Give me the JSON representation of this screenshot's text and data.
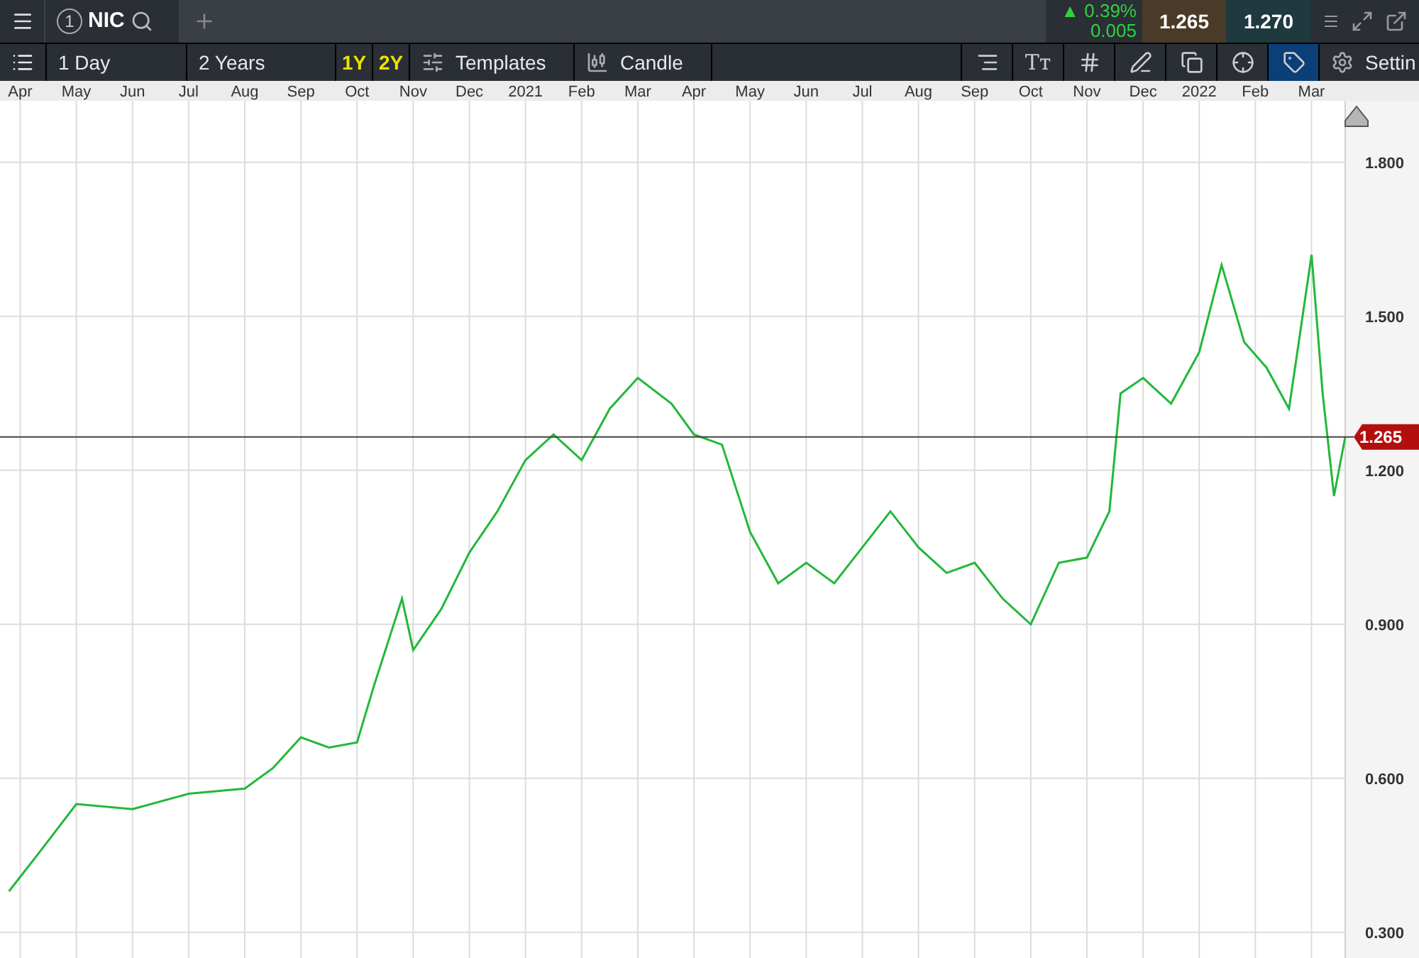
{
  "top_bar": {
    "tab": {
      "number": "1",
      "symbol": "NIC",
      "selected": true
    },
    "change": {
      "arrow": "▲",
      "percent": "0.39%",
      "absolute": "0.005"
    },
    "bid": "1.265",
    "ask": "1.270"
  },
  "toolbar": {
    "interval": "1 Day",
    "range": "2 Years",
    "quick_ranges": [
      {
        "label": "1Y",
        "selected": false
      },
      {
        "label": "2Y",
        "selected": false
      }
    ],
    "templates": "Templates",
    "chart_type": "Candle",
    "tools": [
      {
        "kind": "align",
        "selected": false
      },
      {
        "kind": "text",
        "label": "Tт",
        "selected": false
      },
      {
        "kind": "grid",
        "selected": false
      },
      {
        "kind": "draw",
        "selected": false
      },
      {
        "kind": "copy",
        "selected": false
      },
      {
        "kind": "crosshair",
        "selected": false
      },
      {
        "kind": "tag",
        "selected": true
      }
    ],
    "settings": "Settin"
  },
  "chart": {
    "chart_data": {
      "type": "line",
      "grid": true,
      "xlim": [
        2020.22,
        2022.2167
      ],
      "ylim": [
        0.25,
        1.92
      ],
      "xticks": [
        {
          "value": 2020.25,
          "label": "Apr"
        },
        {
          "value": 2020.3333,
          "label": "May"
        },
        {
          "value": 2020.4167,
          "label": "Jun"
        },
        {
          "value": 2020.5,
          "label": "Jul"
        },
        {
          "value": 2020.5833,
          "label": "Aug"
        },
        {
          "value": 2020.6667,
          "label": "Sep"
        },
        {
          "value": 2020.75,
          "label": "Oct"
        },
        {
          "value": 2020.8333,
          "label": "Nov"
        },
        {
          "value": 2020.9167,
          "label": "Dec"
        },
        {
          "value": 2021,
          "label": "2021"
        },
        {
          "value": 2021.0833,
          "label": "Feb"
        },
        {
          "value": 2021.1667,
          "label": "Mar"
        },
        {
          "value": 2021.25,
          "label": "Apr"
        },
        {
          "value": 2021.3333,
          "label": "May"
        },
        {
          "value": 2021.4167,
          "label": "Jun"
        },
        {
          "value": 2021.5,
          "label": "Jul"
        },
        {
          "value": 2021.5833,
          "label": "Aug"
        },
        {
          "value": 2021.6667,
          "label": "Sep"
        },
        {
          "value": 2021.75,
          "label": "Oct"
        },
        {
          "value": 2021.8333,
          "label": "Nov"
        },
        {
          "value": 2021.9167,
          "label": "Dec"
        },
        {
          "value": 2022,
          "label": "2022"
        },
        {
          "value": 2022.0833,
          "label": "Feb"
        },
        {
          "value": 2022.1667,
          "label": "Mar"
        }
      ],
      "yticks": [
        {
          "value": 0.3,
          "label": "0.300"
        },
        {
          "value": 0.6,
          "label": "0.600"
        },
        {
          "value": 0.9,
          "label": "0.900"
        },
        {
          "value": 1.2,
          "label": "1.200"
        },
        {
          "value": 1.5,
          "label": "1.500"
        },
        {
          "value": 1.8,
          "label": "1.800"
        }
      ],
      "x": [
        2020.2333,
        2020.275,
        2020.3333,
        2020.4167,
        2020.5,
        2020.5833,
        2020.625,
        2020.6667,
        2020.7083,
        2020.75,
        2020.775,
        2020.8167,
        2020.8333,
        2020.875,
        2020.9167,
        2020.9583,
        2021,
        2021.0417,
        2021.0833,
        2021.125,
        2021.1667,
        2021.2167,
        2021.25,
        2021.2917,
        2021.3333,
        2021.375,
        2021.4167,
        2021.4583,
        2021.5,
        2021.5417,
        2021.5833,
        2021.625,
        2021.6667,
        2021.7083,
        2021.75,
        2021.7917,
        2021.8333,
        2021.8667,
        2021.8833,
        2021.9167,
        2021.9583,
        2022,
        2022.0333,
        2022.0667,
        2022.1,
        2022.1333,
        2022.1667,
        2022.1833,
        2022.2,
        2022.2167
      ],
      "series": [
        {
          "color": "#22b83a",
          "values": [
            0.38,
            0.45,
            0.55,
            0.54,
            0.57,
            0.58,
            0.62,
            0.68,
            0.66,
            0.67,
            0.78,
            0.95,
            0.85,
            0.93,
            1.04,
            1.12,
            1.22,
            1.27,
            1.22,
            1.32,
            1.38,
            1.33,
            1.27,
            1.25,
            1.08,
            0.98,
            1.02,
            0.98,
            1.05,
            1.12,
            1.05,
            1.0,
            1.02,
            0.95,
            0.9,
            1.02,
            1.03,
            1.12,
            1.35,
            1.38,
            1.33,
            1.43,
            1.6,
            1.45,
            1.4,
            1.32,
            1.62,
            1.35,
            1.15,
            1.265
          ]
        }
      ],
      "ref_lines": [
        {
          "axis": "y",
          "value": 1.265,
          "label": "1.265"
        }
      ]
    }
  }
}
